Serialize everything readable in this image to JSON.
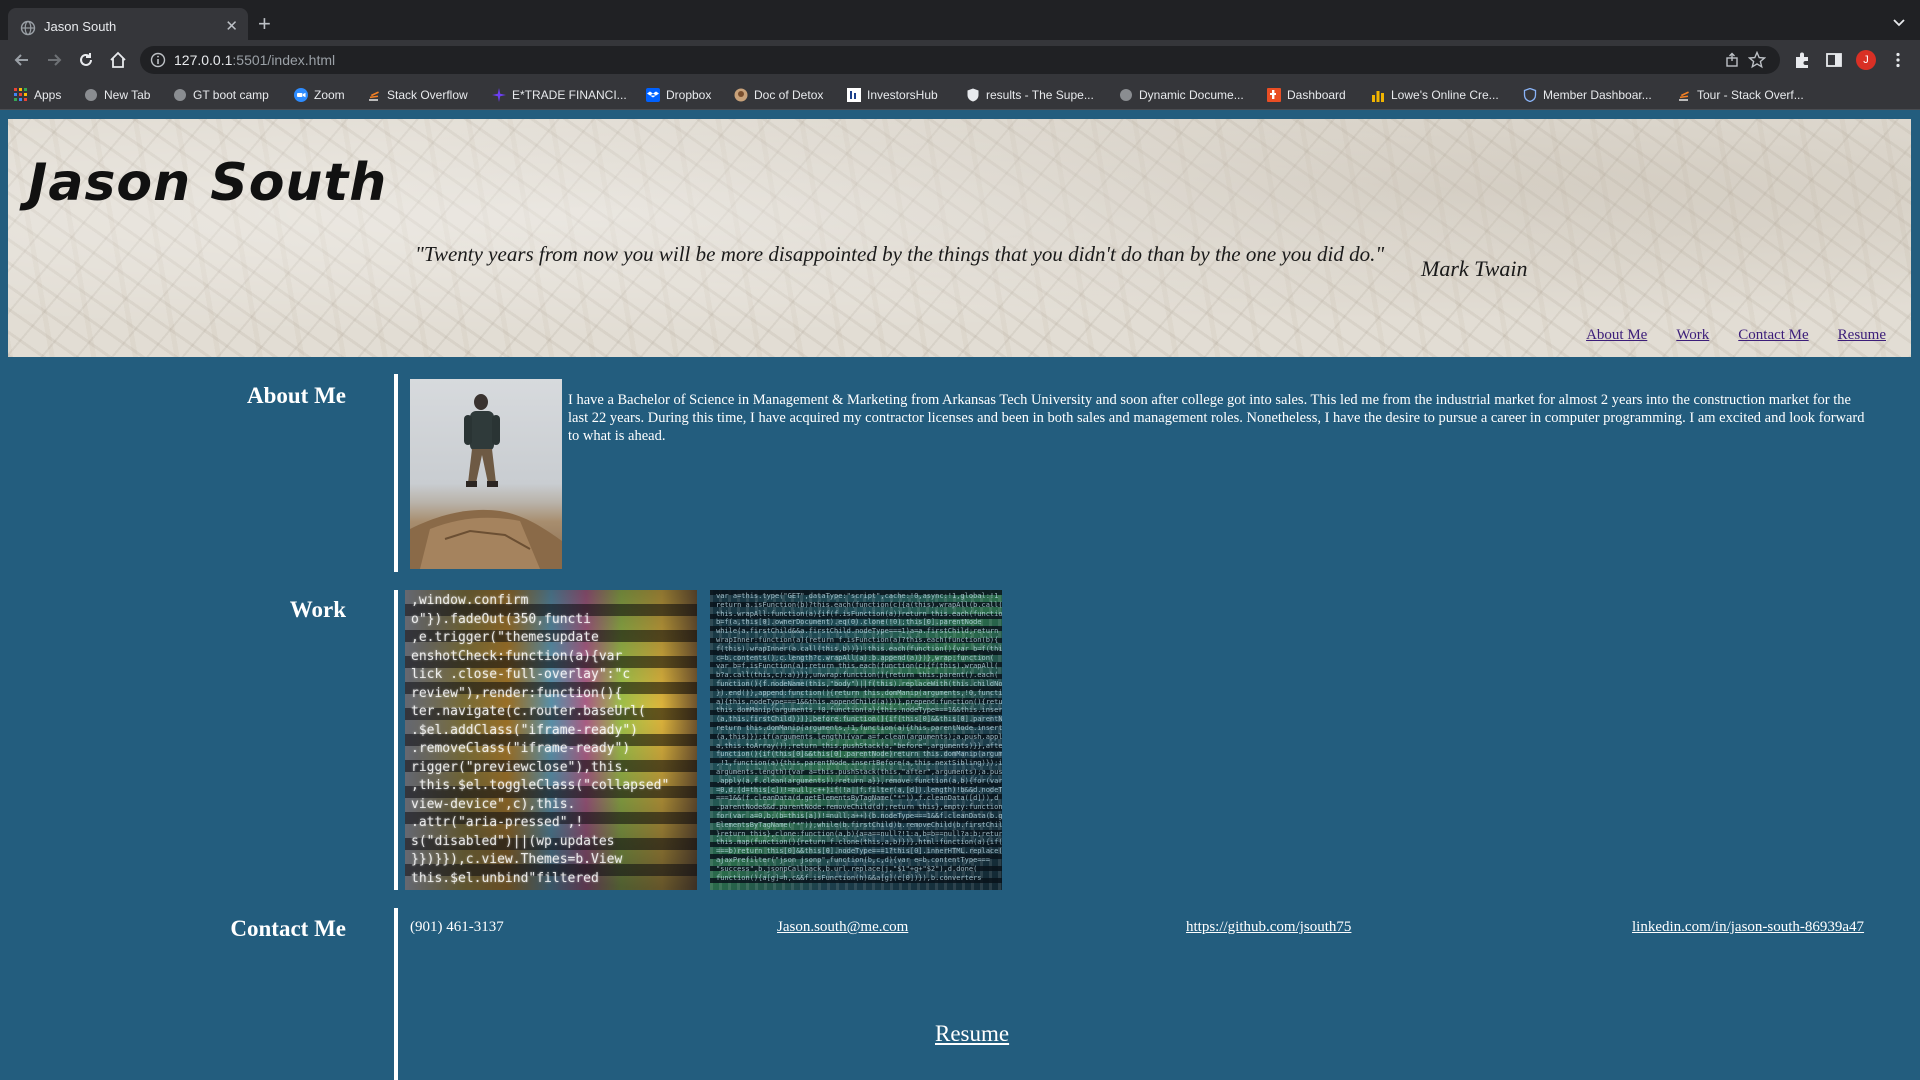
{
  "browser": {
    "tab_title": "Jason South",
    "new_tab_symbol": "+",
    "close_symbol": "✕",
    "url_host": "127.0.0.1",
    "url_rest": ":5501/index.html",
    "profile_initial": "J",
    "bookmarks": [
      "Apps",
      "New Tab",
      "GT boot camp",
      "Zoom",
      "Stack Overflow",
      "E*TRADE FINANCI...",
      "Dropbox",
      "Doc of Detox",
      "InvestorsHub",
      "results - The Supe...",
      "Dynamic Docume...",
      "Dashboard",
      "Lowe's Online Cre...",
      "Member Dashboar...",
      "Tour - Stack Overf..."
    ]
  },
  "header": {
    "site_title": "Jason South",
    "quote": "\"Twenty years from now you will be more disappointed by the things that you didn't do than by the one you did do.\"",
    "quote_author": "Mark Twain",
    "nav": [
      "About Me",
      "Work",
      "Contact Me",
      "Resume"
    ]
  },
  "about": {
    "heading": "About Me",
    "text": "I have a Bachelor of Science in Management & Marketing from Arkansas Tech University and soon after college got into sales. This led me from the industrial market for almost 2 years into the construction market for the last 22 years. During this time, I have acquired my contractor licenses and been in both sales and management roles. Nonetheless, I have the desire to pursue a career in computer programming. I am excited and look forward to what is ahead."
  },
  "work": {
    "heading": "Work",
    "code_lines_1": [
      ",window.confirm",
      "o\"}).fadeOut(350,functi",
      ",e.trigger(\"themesupdate",
      "enshotCheck:function(a){var",
      "lick .close-full-overlay\":\"c",
      "review\"),render:function(){",
      "ter.navigate(c.router.baseUrl(",
      ".$el.addClass(\"iframe-ready\")",
      ".removeClass(\"iframe-ready\")",
      "rigger(\"previewclose\"),this.",
      ",this.$el.toggleClass(\"collapsed\"",
      "view-device\",c),this.",
      ".attr(\"aria-pressed\",!",
      "s(\"disabled\")||(wp.updates",
      "}})}}),c.view.Themes=b.View",
      "this.$el.unbind\"filtered"
    ],
    "code_lines_2": [
      "var a=this.type(\"GET\",dataType:\"script\",cache:!0,async:!1,global:!1",
      "return a.isFunction(b)?this.each(function(c){a(this).wrapAll(b.call(",
      "this.wrapAll:function(a){if(f.isFunction(a))return this.each(function",
      "b=f(a,this[0].ownerDocument).eq(0).clone(!0);this[0].parentNode",
      "while(a.firstChild&&a.firstChild.nodeType===1)a=a.firstChild;return",
      "wrapInner:function(a){return f.isFunction(a)?this.each(function(b){",
      "f(this).wrapInner(a.call(this,b))}):this.each(function(){var b=f(this)",
      "c=b.contents();c.length?c.wrapAll(a):b.append(a)})},wrap:function(",
      "var b=f.isFunction(a);return this.each(function(c){f(this).wrapAll(",
      "b?a.call(this,c):a)})},unwrap:function(){return this.parent().each(",
      "function(){f.nodeName(this,\"body\")||f(this).replaceWith(this.childNodes",
      "}).end()},append:function(){return this.domManip(arguments,!0,function",
      "a){this.nodeType===1&&this.appendChild(a)})},prepend:function(){return",
      "this.domManip(arguments,!0,function(a){this.nodeType===1&&this.insertBefore",
      "(a,this.firstChild)})},before:function(){if(this[0]&&this[0].parentNode",
      "return this.domManip(arguments,!1,function(a){this.parentNode.insertBefore",
      "(a,this)});if(arguments.length){var a=f.clean(arguments);a.push.apply(",
      "a,this.toArray());return this.pushStack(a,\"before\",arguments)}},after:",
      "function(){if(this[0]&&this[0].parentNode)return this.domManip(arguments",
      ",!1,function(a){this.parentNode.insertBefore(a,this.nextSibling)});if(",
      "arguments.length){var a=this.pushStack(this,\"after\",arguments);a.push",
      ".apply(a,f.clean(arguments));return a}},remove:function(a,b){for(var c",
      "=0,d;(d=this[c])!=null;c++)if(!a||f.filter(a,[d]).length)!b&&d.nodeType",
      "===1&&(f.cleanData(d.getElementsByTagName(\"*\")),f.cleanData([d])),d",
      ".parentNode&&d.parentNode.removeChild(d);return this},empty:function(){",
      "for(var a=0,b;(b=this[a])!=null;a++){b.nodeType===1&&f.cleanData(b.get",
      "ElementsByTagName(\"*\"));while(b.firstChild)b.removeChild(b.firstChild)",
      "}return this},clone:function(a,b){a=a==null?!1:a,b=b==null?a:b;return",
      "this.map(function(){return f.clone(this,a,b)})},html:function(a){if(a",
      "===b)return this[0]&&this[0].nodeType===1?this[0].innerHTML.replace(",
      "ajaxPrefilter(\"json jsonp\",function(b,c,d){var e=b.contentType===",
      "\"success\",b.jsonpCallback,b.url.replace(j,\"$1\"+g+\"$2\"),d.done(",
      "function(){a[g]=h,c&&f.isFunction(h)&&a[g](c[0])}),b.converters"
    ]
  },
  "contact": {
    "heading": "Contact Me",
    "phone": "(901) 461-3137",
    "email": "Jason.south@me.com",
    "github": "https://github.com/jsouth75",
    "linkedin": "linkedin.com/in/jason-south-86939a47",
    "resume": "Resume"
  },
  "colors": {
    "page_background": "#235d7e",
    "text": "#ffffff",
    "nav_link": "#3c1e7a"
  }
}
